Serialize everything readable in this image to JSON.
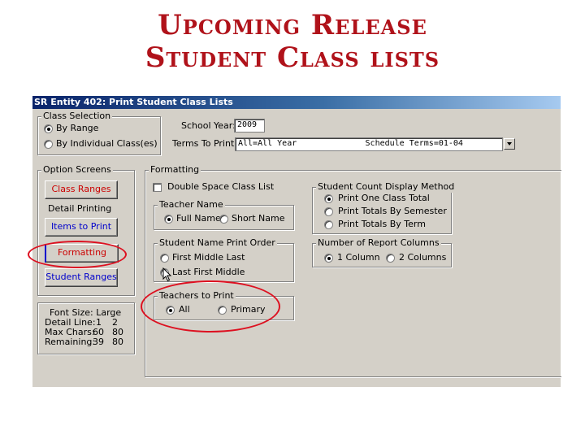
{
  "slide": {
    "title_line1": "Upcoming Release",
    "title_line2": "Student Class lists"
  },
  "window": {
    "title": "SR Entity 402: Print Student Class Lists"
  },
  "class_selection": {
    "label": "Class Selection",
    "by_range": "By Range",
    "by_individual": "By Individual Class(es)",
    "selected": "By Range"
  },
  "school_year": {
    "label": "School Year:",
    "value": "2009"
  },
  "terms": {
    "label": "Terms To Print:",
    "value": "All=All Year              Schedule Terms=01-04"
  },
  "option_screens": {
    "label": "Option Screens",
    "class_ranges": "Class Ranges",
    "detail_printing": "Detail Printing",
    "items_to_print": "Items to Print",
    "formatting": "Formatting",
    "student_ranges": "Student Ranges"
  },
  "font_info": {
    "font_size": "Font Size: Large",
    "detail_line_label": "Detail Line:",
    "detail_line_a": "1",
    "detail_line_b": "2",
    "max_chars_label": "Max Chars:",
    "max_chars_a": "60",
    "max_chars_b": "80",
    "remaining_label": "Remaining:",
    "remaining_a": "39",
    "remaining_b": "80"
  },
  "formatting": {
    "label": "Formatting",
    "double_space": "Double Space Class List",
    "double_space_checked": false
  },
  "teacher_name": {
    "label": "Teacher Name",
    "full_name": "Full Name",
    "short_name": "Short Name",
    "selected": "Full Name"
  },
  "student_name_order": {
    "label": "Student Name Print Order",
    "first_middle_last": "First Middle Last",
    "last_first_middle": "Last First Middle",
    "selected": "Last First Middle"
  },
  "teachers_to_print": {
    "label": "Teachers to Print",
    "all": "All",
    "primary": "Primary",
    "selected": "All"
  },
  "student_count": {
    "label": "Student Count Display Method",
    "one_total": "Print One Class Total",
    "by_semester": "Print Totals By Semester",
    "by_term": "Print Totals By Term",
    "selected": "Print One Class Total"
  },
  "report_columns": {
    "label": "Number of Report Columns",
    "one": "1 Column",
    "two": "2 Columns",
    "selected": "1 Column"
  },
  "colors": {
    "title_red": "#b0121a",
    "highlight_red": "#dd1020",
    "window_gray": "#d4d0c8",
    "button_blue_text": "#0000cc"
  }
}
